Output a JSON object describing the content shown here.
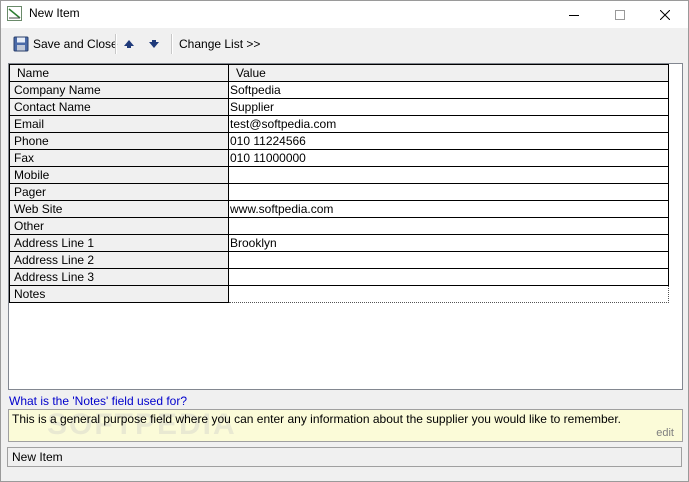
{
  "window": {
    "title": "New Item"
  },
  "toolbar": {
    "save_label": "Save and Close",
    "up_icon": "arrow-up-icon",
    "down_icon": "arrow-down-icon",
    "change_list_label": "Change List >>"
  },
  "grid": {
    "columns": [
      "Name",
      "Value"
    ],
    "rows": [
      {
        "name": "Company Name",
        "value": "Softpedia"
      },
      {
        "name": "Contact Name",
        "value": "Supplier"
      },
      {
        "name": "Email",
        "value": "test@softpedia.com"
      },
      {
        "name": "Phone",
        "value": "010 11224566"
      },
      {
        "name": "Fax",
        "value": "010 11000000"
      },
      {
        "name": "Mobile",
        "value": ""
      },
      {
        "name": "Pager",
        "value": ""
      },
      {
        "name": "Web Site",
        "value": "www.softpedia.com"
      },
      {
        "name": "Other",
        "value": ""
      },
      {
        "name": "Address Line 1",
        "value": "Brooklyn"
      },
      {
        "name": "Address Line 2",
        "value": ""
      },
      {
        "name": "Address Line 3",
        "value": ""
      },
      {
        "name": "Notes",
        "value": ""
      }
    ]
  },
  "help": {
    "title": "What is the 'Notes' field used for?",
    "text": "This is a general purpose field where you can enter any information about the supplier you would like to remember.",
    "edit_label": "edit",
    "watermark": "SOFTPEDIA"
  },
  "status": {
    "text": "New Item"
  },
  "colors": {
    "help_bg": "#fbfbd8",
    "link": "#0000cc"
  }
}
